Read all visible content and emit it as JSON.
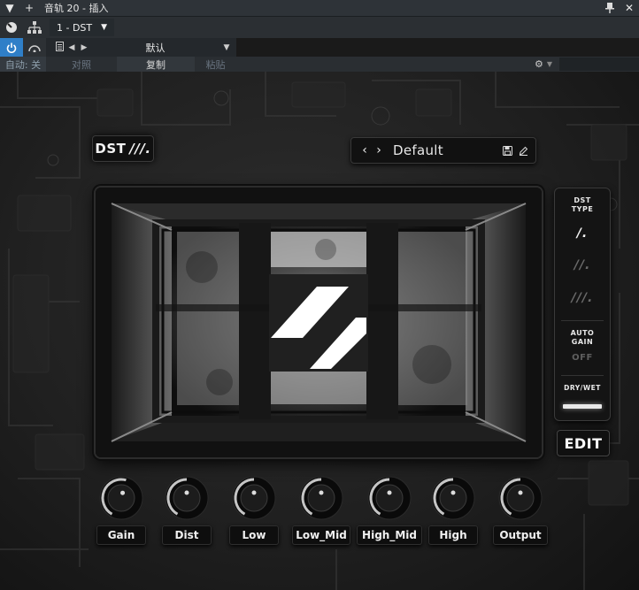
{
  "host": {
    "window_title": "音轨 20 - 插入",
    "track_name": "1 - DST",
    "preset_name": "默认",
    "auto_label": "自动: 关",
    "compare_label": "对照",
    "copy_label": "复制",
    "paste_label": "粘贴"
  },
  "plugin": {
    "logo_text": "DST",
    "logo_slashes": "///.",
    "preset_name": "Default",
    "side_panel": {
      "dst_type_label_1": "DST",
      "dst_type_label_2": "TYPE",
      "types": [
        "/.",
        "//.",
        "///."
      ],
      "selected_type_index": 0,
      "auto_gain_label_1": "AUTO",
      "auto_gain_label_2": "GAIN",
      "auto_gain_value": "OFF",
      "dry_wet_label": "DRY/WET",
      "dry_wet_value": 1.0
    },
    "edit_label": "EDIT",
    "knobs": [
      {
        "label": "Gain",
        "value": 0.55
      },
      {
        "label": "Dist",
        "value": 0.5
      },
      {
        "label": "Low",
        "value": 0.5
      },
      {
        "label": "Low_Mid",
        "value": 0.5
      },
      {
        "label": "High_Mid",
        "value": 0.5
      },
      {
        "label": "High",
        "value": 0.5
      },
      {
        "label": "Output",
        "value": 0.5
      }
    ]
  },
  "colors": {
    "host_accent": "#2f7fc8",
    "plugin_text": "#f0f0f0",
    "plugin_dim_text": "#6a6a6a"
  }
}
